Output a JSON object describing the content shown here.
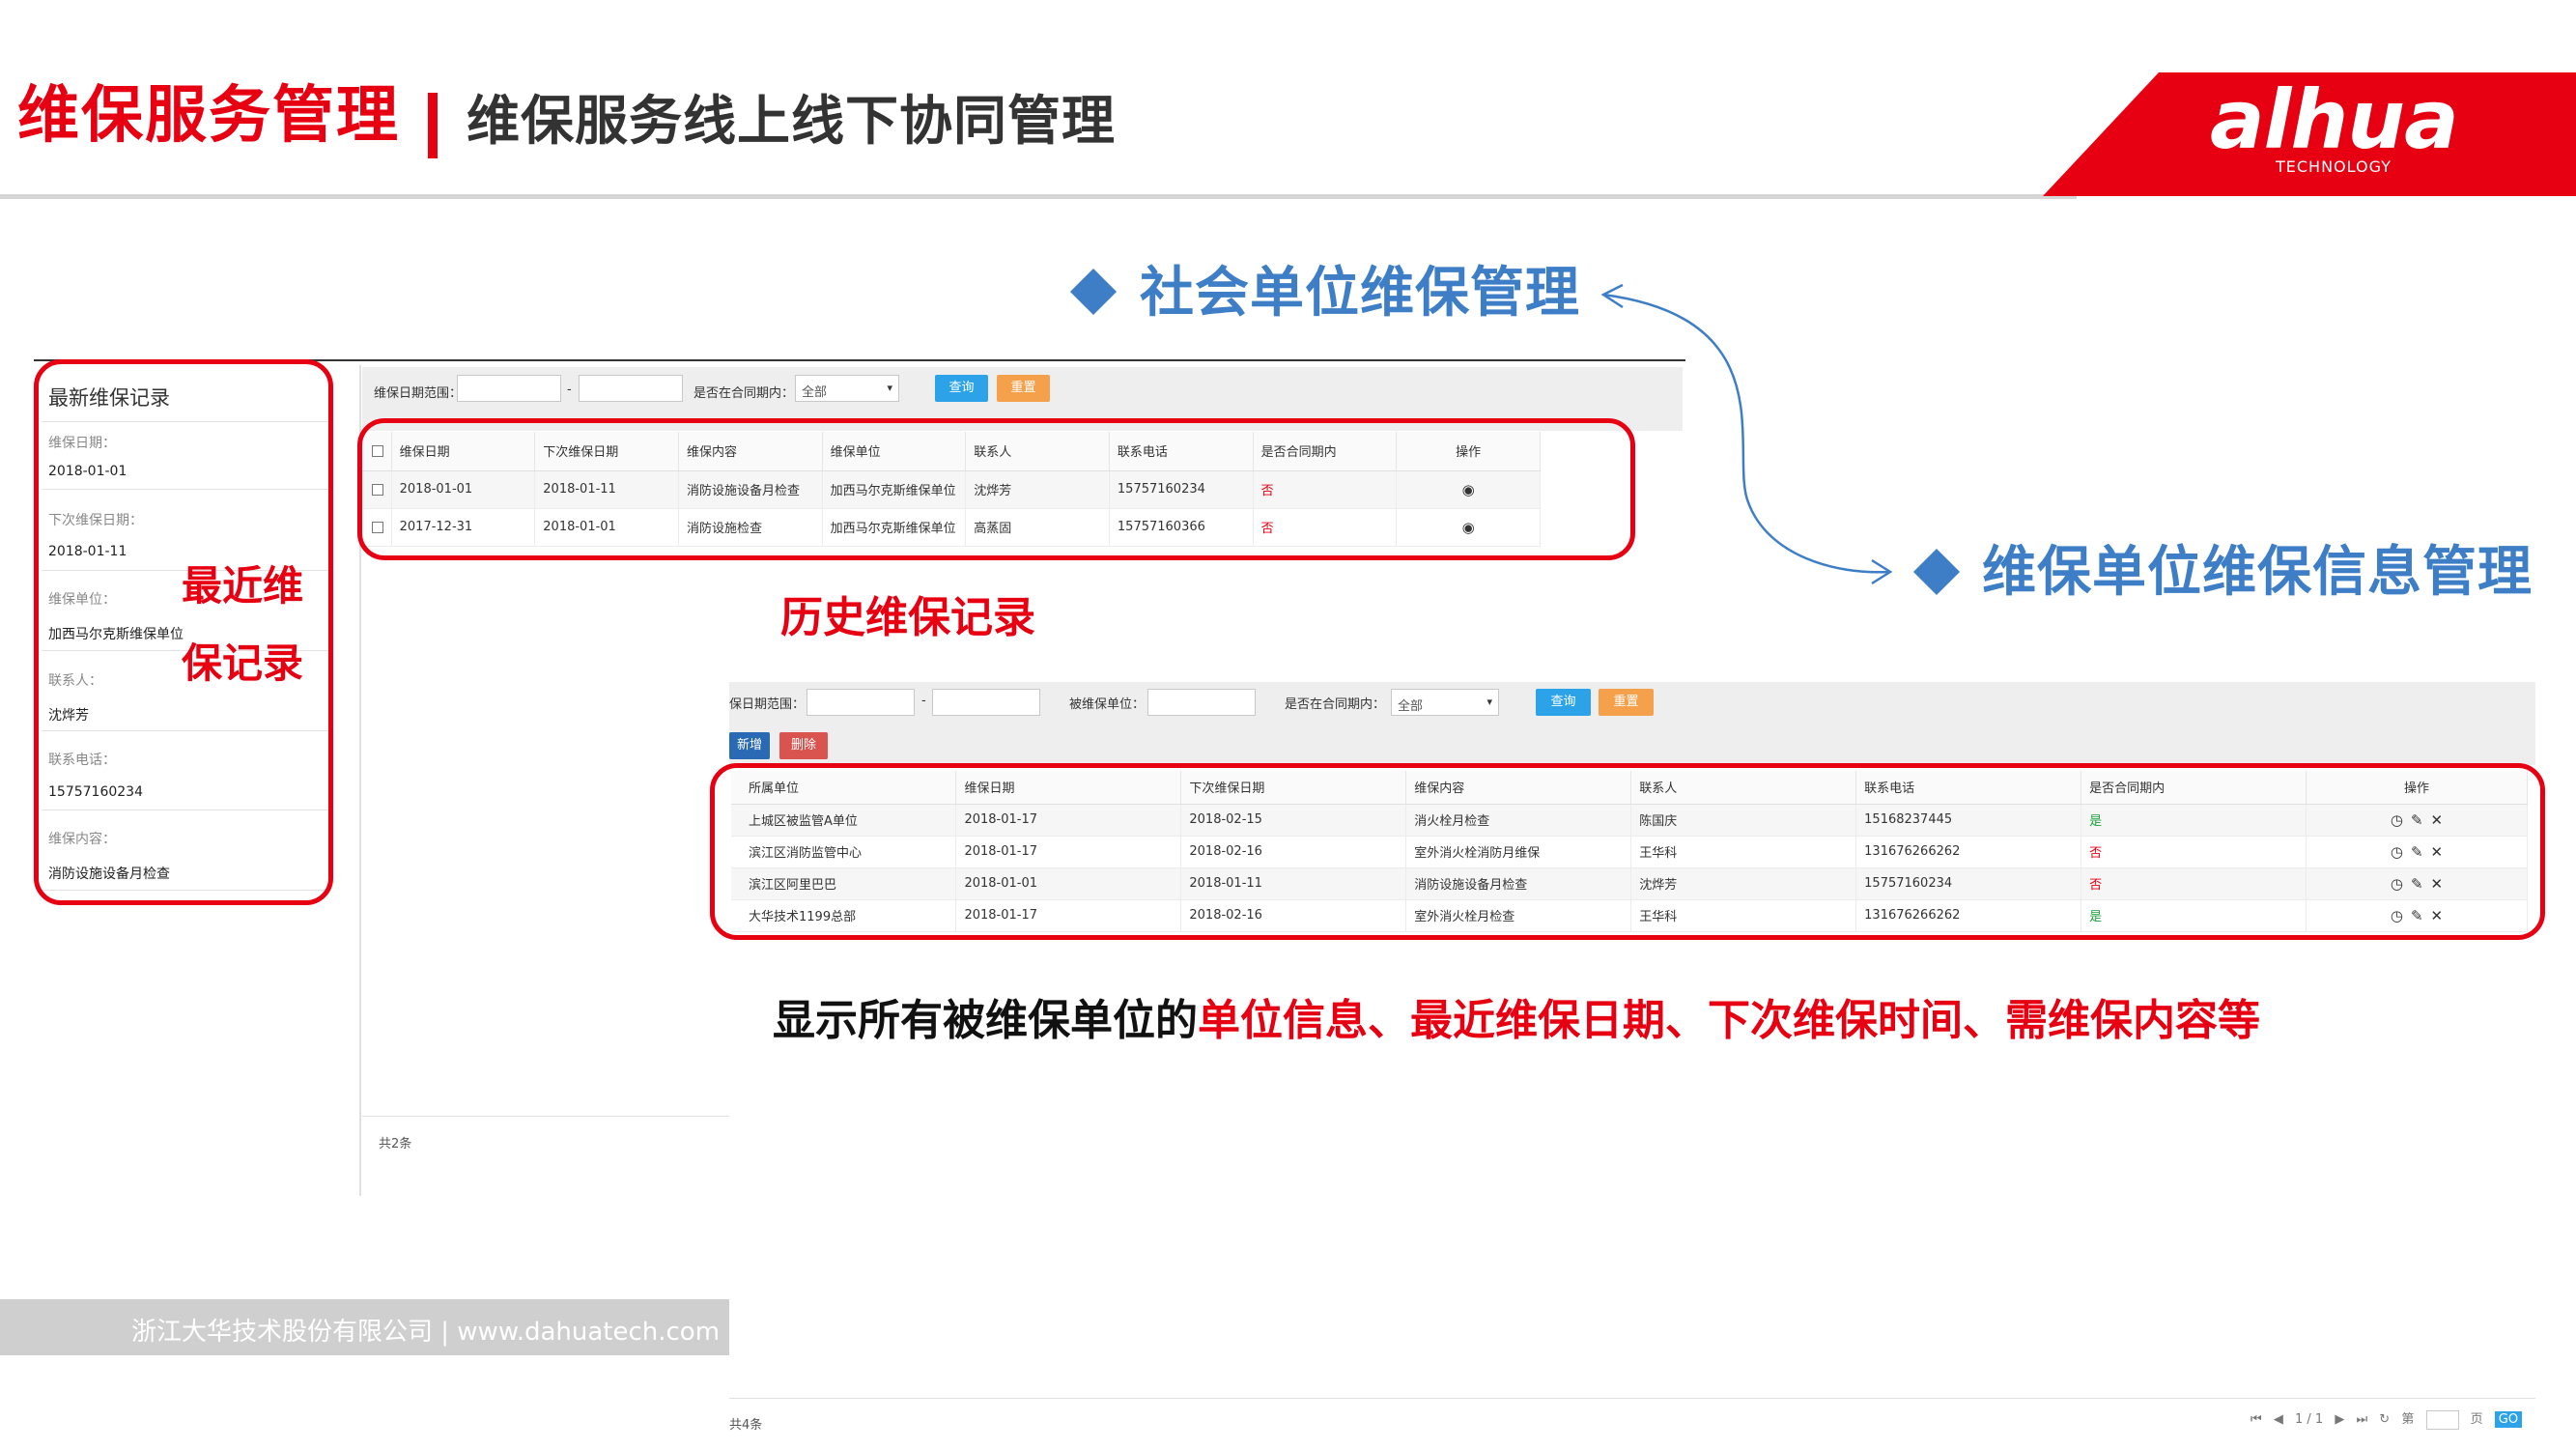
{
  "header": {
    "title": "维保服务管理",
    "subtitle": "维保服务线上线下协同管理",
    "logo_text": "alhua",
    "logo_sub": "TECHNOLOGY",
    "brand_color": "#e60012"
  },
  "callouts": {
    "social_unit": "社会单位维保管理",
    "maint_unit": "维保单位维保信息管理",
    "color": "#3d7ec6"
  },
  "latest_record": {
    "title": "最新维保记录",
    "fields": [
      {
        "label": "维保日期：",
        "value": "2018-01-01"
      },
      {
        "label": "下次维保日期：",
        "value": "2018-01-11"
      },
      {
        "label": "维保单位：",
        "value": "加西马尔克斯维保单位"
      },
      {
        "label": "联系人：",
        "value": "沈烨芳"
      },
      {
        "label": "联系电话：",
        "value": "15757160234"
      },
      {
        "label": "维保内容：",
        "value": "消防设施设备月检查"
      }
    ],
    "annotation_line1": "最近维",
    "annotation_line2": "保记录"
  },
  "history": {
    "filter": {
      "date_range_label": "维保日期范围：",
      "dash": "-",
      "contract_label": "是否在合同期内：",
      "contract_value": "全部",
      "query_button": "查询",
      "reset_button": "重置"
    },
    "columns": [
      "维保日期",
      "下次维保日期",
      "维保内容",
      "维保单位",
      "联系人",
      "联系电话",
      "是否合同期内",
      "操作"
    ],
    "rows": [
      {
        "date": "2018-01-01",
        "next": "2018-01-11",
        "content": "消防设施设备月检查",
        "unit": "加西马尔克斯维保单位",
        "contact": "沈烨芳",
        "phone": "15757160234",
        "in_contract": "否"
      },
      {
        "date": "2017-12-31",
        "next": "2018-01-01",
        "content": "消防设施检查",
        "unit": "加西马尔克斯维保单位",
        "contact": "高蒸固",
        "phone": "15757160366",
        "in_contract": "否"
      }
    ],
    "annotation": "历史维保记录",
    "total": "共2条"
  },
  "maint_info": {
    "filter": {
      "date_range_label": "保日期范围：",
      "dash": "-",
      "unit_label": "被维保单位：",
      "contract_label": "是否在合同期内：",
      "contract_value": "全部",
      "query_button": "查询",
      "reset_button": "重置",
      "add_button": "新增",
      "delete_button": "删除"
    },
    "columns": [
      "所属单位",
      "维保日期",
      "下次维保日期",
      "维保内容",
      "联系人",
      "联系电话",
      "是否合同期内",
      "操作"
    ],
    "rows": [
      {
        "unit": "上城区被监管A单位",
        "date": "2018-01-17",
        "next": "2018-02-15",
        "content": "消火栓月检查",
        "contact": "陈国庆",
        "phone": "15168237445",
        "in_contract": "是"
      },
      {
        "unit": "滨江区消防监管中心",
        "date": "2018-01-17",
        "next": "2018-02-16",
        "content": "室外消火栓消防月维保",
        "contact": "王华科",
        "phone": "131676266262",
        "in_contract": "否"
      },
      {
        "unit": "滨江区阿里巴巴",
        "date": "2018-01-01",
        "next": "2018-01-11",
        "content": "消防设施设备月检查",
        "contact": "沈烨芳",
        "phone": "15757160234",
        "in_contract": "否"
      },
      {
        "unit": "大华技术1199总部",
        "date": "2018-01-17",
        "next": "2018-02-16",
        "content": "室外消火栓月检查",
        "contact": "王华科",
        "phone": "131676266262",
        "in_contract": "是"
      }
    ],
    "total": "共4条",
    "pager": {
      "page": "1 / 1",
      "page_label": "第",
      "page_unit": "页",
      "go": "GO"
    }
  },
  "description": {
    "prefix": "显示所有被维保单位的",
    "highlight": "单位信息、最近维保日期、下次维保时间、需维保内容等"
  },
  "footer": {
    "company": "浙江大华技术股份有限公司 | www.dahuatech.com"
  }
}
